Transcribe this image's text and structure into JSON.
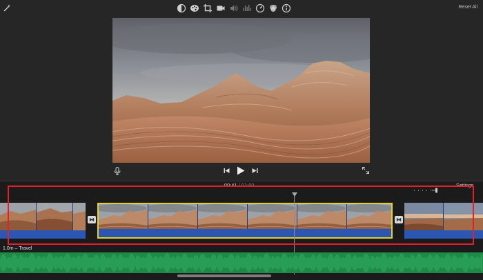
{
  "toolbar": {
    "tools": [
      "color-balance-icon",
      "color-correction-icon",
      "crop-icon",
      "stabilization-icon",
      "volume-icon",
      "noise-reduction-icon",
      "speed-icon",
      "clip-filter-icon",
      "info-icon"
    ],
    "reset_all": "Reset All"
  },
  "timeline": {
    "timecode_current": "00:41",
    "timecode_separator": "/",
    "timecode_total": "01:00",
    "settings": "Settings",
    "music_label": "1.0m – Travel"
  },
  "colors": {
    "selection": "#e5cf2b",
    "highlight": "#e2202a",
    "audio_clip": "#2c56b3",
    "music": "#1f8a48"
  }
}
